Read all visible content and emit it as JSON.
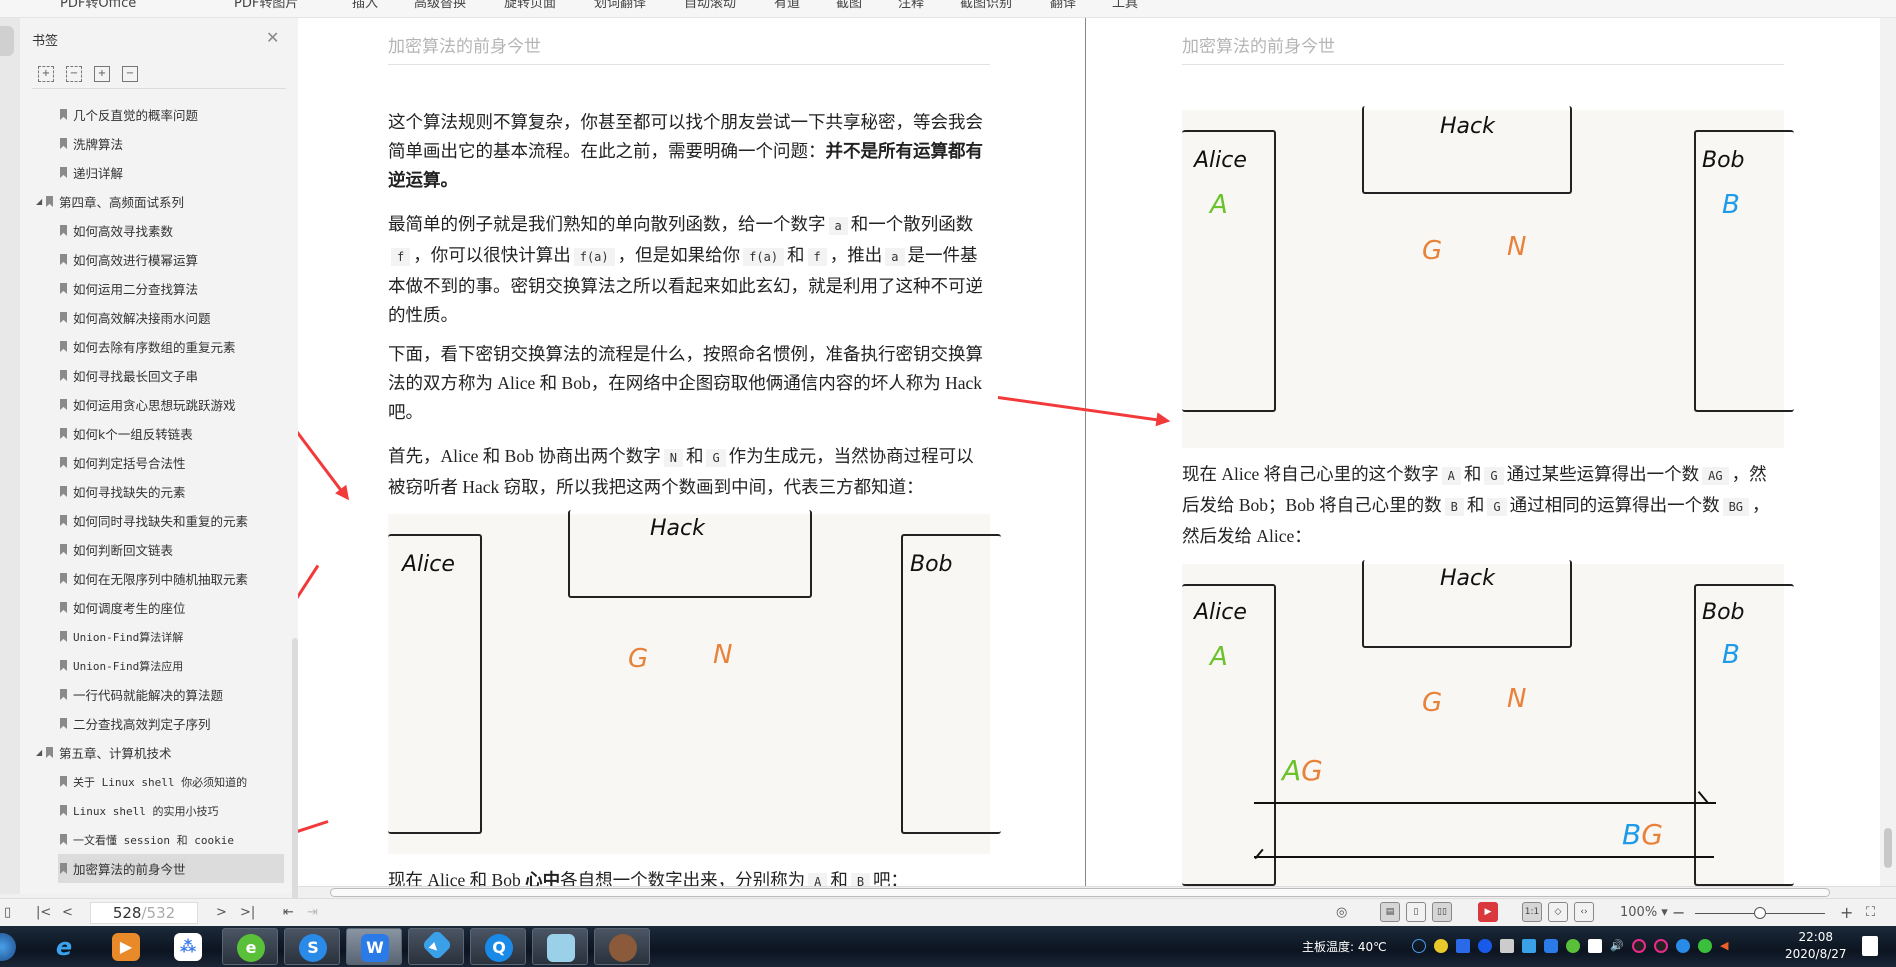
{
  "toolbar": {
    "items": [
      "PDF转Office",
      "PDF转图片",
      "插入",
      "高级替换",
      "旋转页面",
      "划词翻译",
      "自动滚动",
      "有道",
      "截图",
      "注释",
      "截图识别",
      "翻译",
      "工具"
    ]
  },
  "sidebar": {
    "title": "书签",
    "close_icon": "close-icon",
    "tools": [
      "expand-all-icon",
      "collapse-all-icon",
      "add-bookmark-icon",
      "remove-bookmark-icon"
    ],
    "items": [
      {
        "level": 2,
        "label": "几个反直觉的概率问题"
      },
      {
        "level": 2,
        "label": "洗牌算法"
      },
      {
        "level": 2,
        "label": "递归详解"
      },
      {
        "level": 1,
        "label": "第四章、高频面试系列",
        "expanded": true
      },
      {
        "level": 2,
        "label": "如何高效寻找素数"
      },
      {
        "level": 2,
        "label": "如何高效进行模幂运算"
      },
      {
        "level": 2,
        "label": "如何运用二分查找算法"
      },
      {
        "level": 2,
        "label": "如何高效解决接雨水问题"
      },
      {
        "level": 2,
        "label": "如何去除有序数组的重复元素"
      },
      {
        "level": 2,
        "label": "如何寻找最长回文子串"
      },
      {
        "level": 2,
        "label": "如何运用贪心思想玩跳跃游戏"
      },
      {
        "level": 2,
        "label": "如何k个一组反转链表"
      },
      {
        "level": 2,
        "label": "如何判定括号合法性"
      },
      {
        "level": 2,
        "label": "如何寻找缺失的元素"
      },
      {
        "level": 2,
        "label": "如何同时寻找缺失和重复的元素"
      },
      {
        "level": 2,
        "label": "如何判断回文链表"
      },
      {
        "level": 2,
        "label": "如何在无限序列中随机抽取元素"
      },
      {
        "level": 2,
        "label": "如何调度考生的座位"
      },
      {
        "level": 2,
        "label": "Union-Find算法详解",
        "mono": true
      },
      {
        "level": 2,
        "label": "Union-Find算法应用",
        "mono": true
      },
      {
        "level": 2,
        "label": "一行代码就能解决的算法题"
      },
      {
        "level": 2,
        "label": "二分查找高效判定子序列"
      },
      {
        "level": 1,
        "label": "第五章、计算机技术",
        "expanded": true
      },
      {
        "level": 2,
        "label": "关于 Linux shell 你必须知道的",
        "mono": true
      },
      {
        "level": 2,
        "label": "Linux shell 的实用小技巧",
        "mono": true
      },
      {
        "level": 2,
        "label": "一文看懂 session 和 cookie",
        "mono": true
      },
      {
        "level": 2,
        "label": "加密算法的前身今世",
        "active": true
      }
    ]
  },
  "document": {
    "left_page": {
      "header": "加密算法的前身今世",
      "p1_a": "这个算法规则不算复杂，你甚至都可以找个朋友尝试一下共享秘密，等会我会简单画出它的基本流程。在此之前，需要明确一个问题：",
      "p1_b": "并不是所有运算都有逆运算。",
      "p2": [
        "最简单的例子就是我们熟知的单向散列函数，给一个数字",
        "a",
        "和一个散列函数",
        "f",
        "，你可以很快计算出",
        "f(a)",
        "，但是如果给你",
        "f(a)",
        "和",
        "f",
        "，推出",
        "a",
        "是一件基本做不到的事。密钥交换算法之所以看起来如此玄幻，就是利用了这种不可逆的性质。"
      ],
      "p3": "下面，看下密钥交换算法的流程是什么，按照命名惯例，准备执行密钥交换算法的双方称为 Alice 和 Bob，在网络中企图窃取他俩通信内容的坏人称为 Hack 吧。",
      "p4": [
        "首先，Alice 和 Bob 协商出两个数字",
        "N",
        "和",
        "G",
        "作为生成元，当然协商过程可以被窃听者 Hack 窃取，所以我把这两个数画到中间，代表三方都知道："
      ],
      "p5": [
        "现在 Alice 和 Bob ",
        "心中",
        "各自想一个数字出来，分别称为",
        "A",
        "和",
        "B",
        "吧："
      ],
      "diagram1": {
        "alice": "Alice",
        "bob": "Bob",
        "hack": "Hack",
        "g": "G",
        "n": "N"
      }
    },
    "right_page": {
      "header": "加密算法的前身今世",
      "diagram2": {
        "alice": "Alice",
        "bob": "Bob",
        "hack": "Hack",
        "a": "A",
        "b": "B",
        "g": "G",
        "n": "N"
      },
      "p1": [
        "现在 Alice 将自己心里的这个数字",
        "A",
        "和",
        "G",
        "通过某些运算得出一个数",
        "AG",
        "，然后发给 Bob；Bob 将自己心里的数",
        "B",
        "和",
        "G",
        "通过相同的运算得出一个数",
        "BG",
        "，然后发给 Alice："
      ],
      "diagram3": {
        "alice": "Alice",
        "bob": "Bob",
        "hack": "Hack",
        "a": "A",
        "b": "B",
        "g": "G",
        "n": "N",
        "ag_a": "A",
        "ag_g": "G",
        "bg_b": "B",
        "bg_g": "G"
      }
    }
  },
  "statusbar": {
    "current_page": "528",
    "total_pages": "/532",
    "zoom": "100%",
    "zoom_level_percent": 100
  },
  "taskbar": {
    "temp": "主板温度: 40℃",
    "time": "22:08",
    "date": "2020/8/27"
  },
  "colors": {
    "alice_a": "#6cc22a",
    "bob_b": "#1e9be8",
    "shared": "#e8823a",
    "annotation_arrow": "#f23a3a",
    "accent": "#3a86e8"
  }
}
